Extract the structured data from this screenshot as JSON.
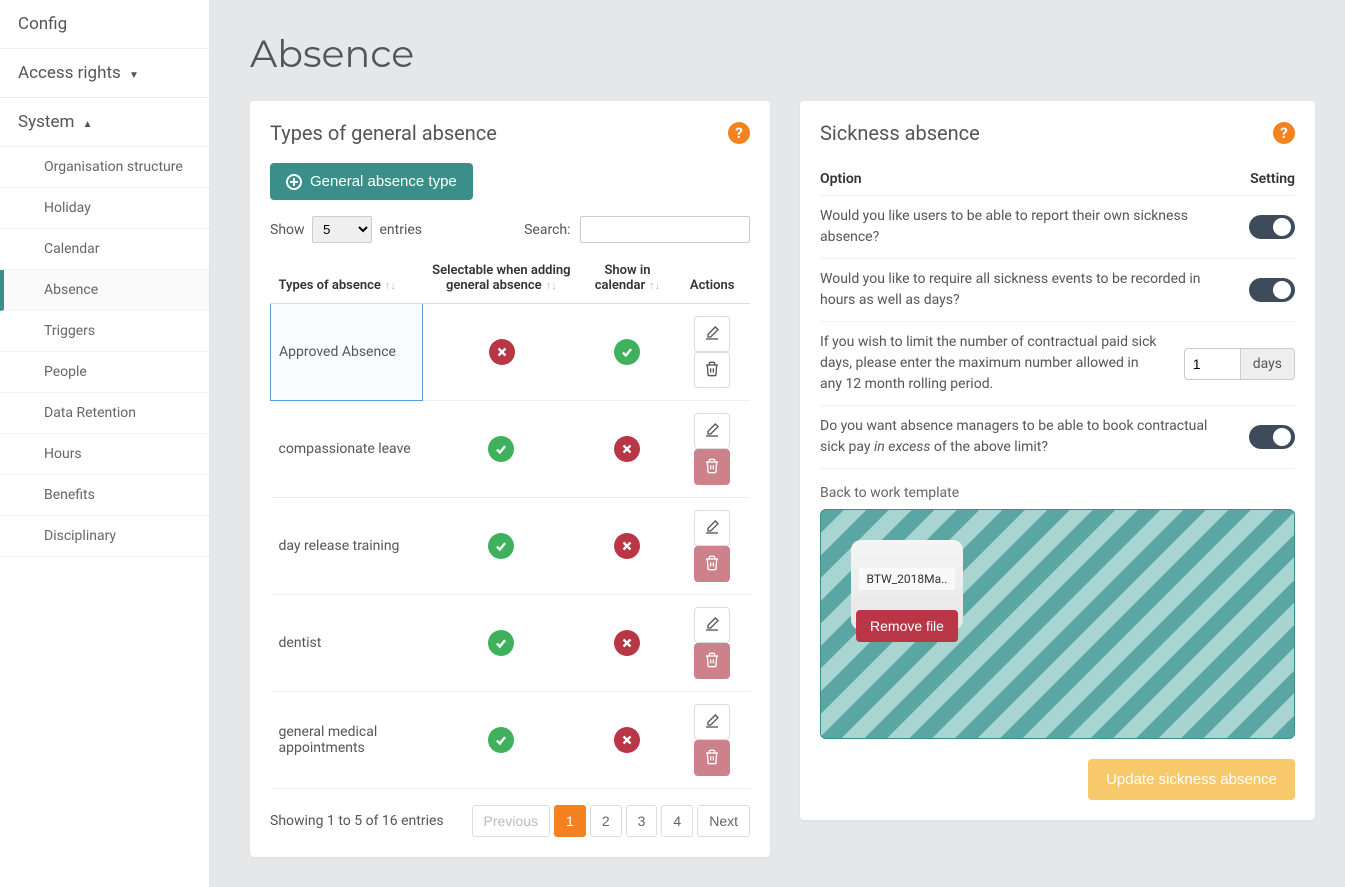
{
  "sidebar": {
    "config_label": "Config",
    "access_rights_label": "Access rights",
    "system_label": "System",
    "items": [
      "Organisation structure",
      "Holiday",
      "Calendar",
      "Absence",
      "Triggers",
      "People",
      "Data Retention",
      "Hours",
      "Benefits",
      "Disciplinary"
    ],
    "active_index": 3
  },
  "page": {
    "title": "Absence"
  },
  "general": {
    "title": "Types of general absence",
    "add_button": "General absence type",
    "show_label": "Show",
    "entries_label": "entries",
    "page_size": "5",
    "search_label": "Search:",
    "search_value": "",
    "columns": [
      "Types of absence",
      "Selectable when adding general absence",
      "Show in calendar",
      "Actions"
    ],
    "rows": [
      {
        "name": "Approved Absence",
        "selectable": false,
        "show": true,
        "delete_locked": false,
        "selected": true
      },
      {
        "name": "compassionate leave",
        "selectable": true,
        "show": false,
        "delete_locked": true
      },
      {
        "name": "day release training",
        "selectable": true,
        "show": false,
        "delete_locked": true
      },
      {
        "name": "dentist",
        "selectable": true,
        "show": false,
        "delete_locked": true
      },
      {
        "name": "general medical appointments",
        "selectable": true,
        "show": false,
        "delete_locked": true
      }
    ],
    "info": "Showing 1 to 5 of 16 entries",
    "pagination": {
      "prev": "Previous",
      "next": "Next",
      "pages": [
        "1",
        "2",
        "3",
        "4"
      ],
      "active": "1"
    }
  },
  "sickness": {
    "title": "Sickness absence",
    "col_option": "Option",
    "col_setting": "Setting",
    "opt1": "Would you like users to be able to report their own sickness absence?",
    "opt2": "Would you like to require all sickness events to be recorded in hours as well as days?",
    "opt3": "If you wish to limit the number of contractual paid sick days, please enter the maximum number allowed in any 12 month rolling period.",
    "opt3_value": "1",
    "opt3_unit": "days",
    "opt4_a": "Do you want absence managers to be able to book contractual sick pay ",
    "opt4_em": "in excess",
    "opt4_b": " of the above limit?",
    "template_label": "Back to work template",
    "file_name": "BTW_2018Ma..",
    "remove_file": "Remove file",
    "update_button": "Update sickness absence"
  }
}
